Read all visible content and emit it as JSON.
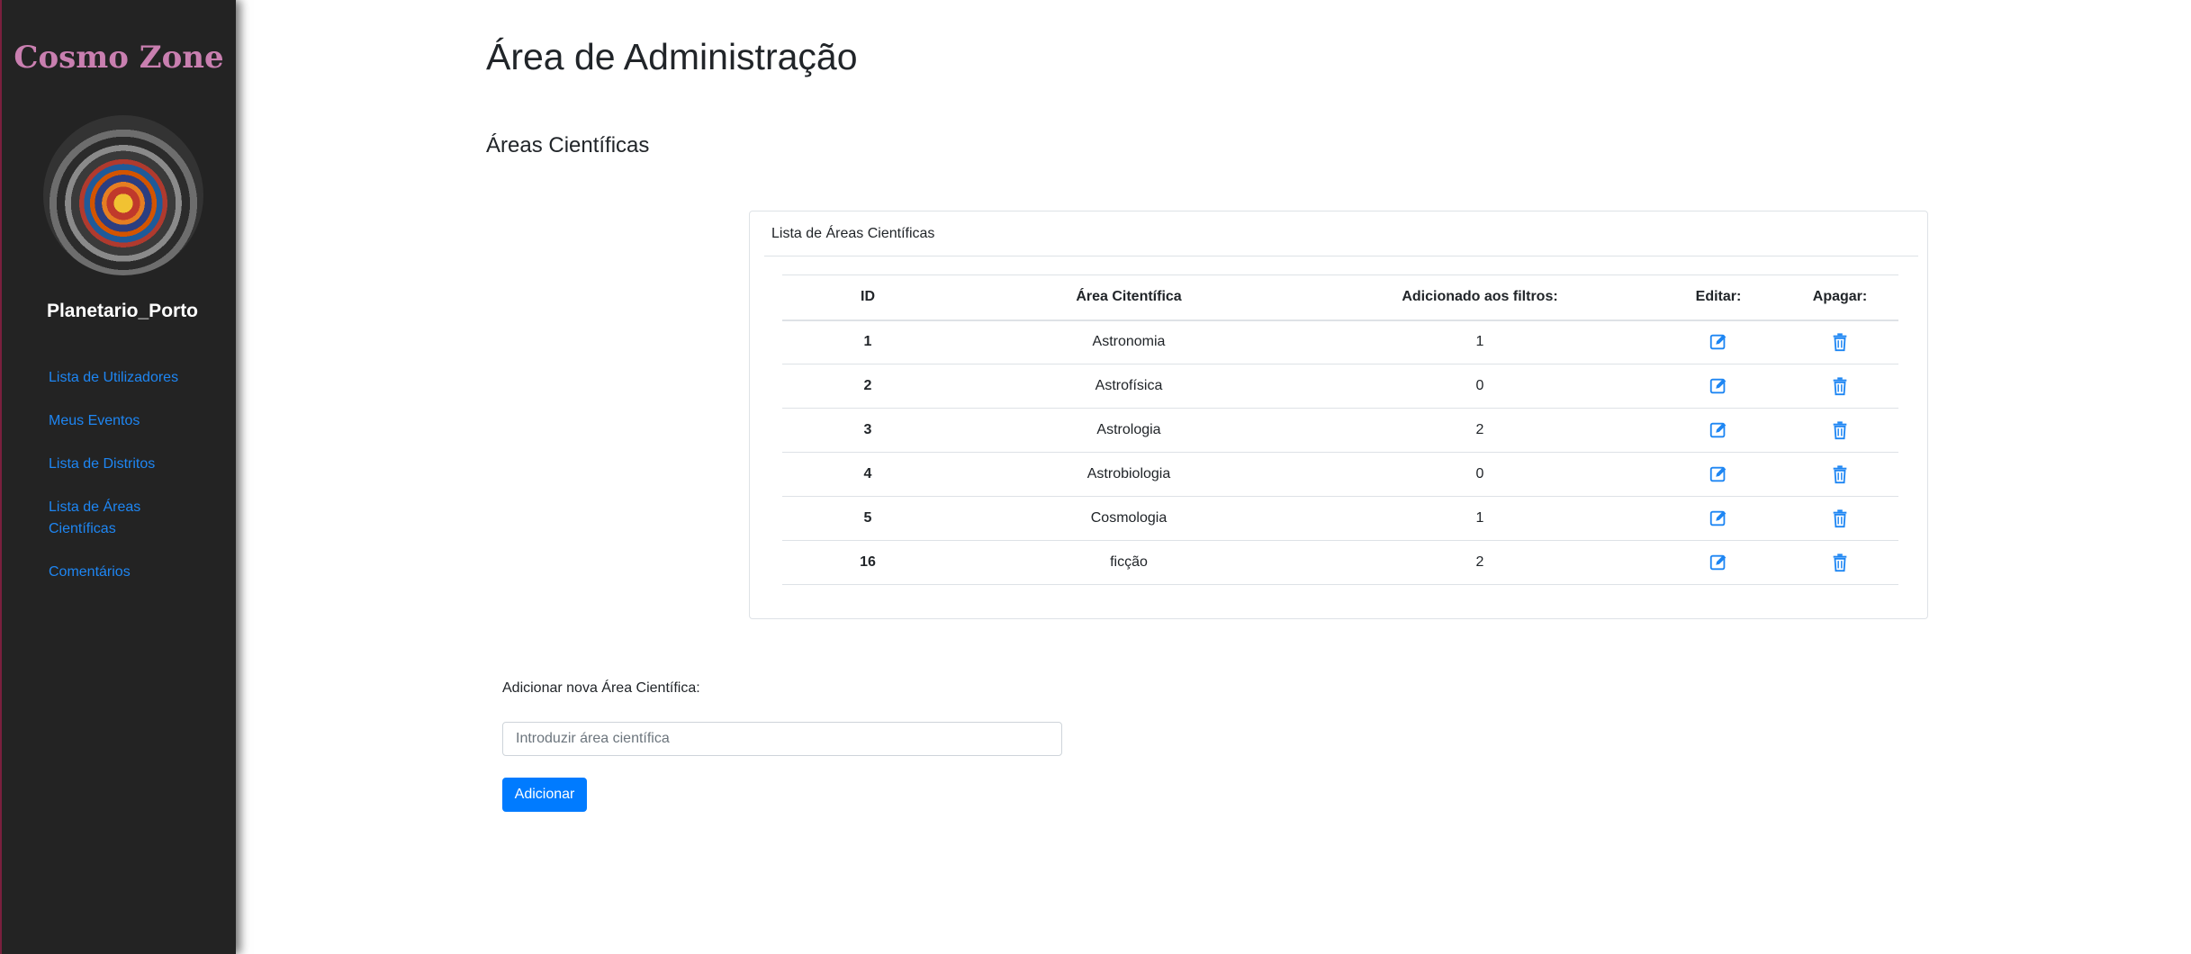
{
  "sidebar": {
    "brand": "Cosmo Zone",
    "username": "Planetario_Porto",
    "nav": [
      {
        "label": "Lista de Utilizadores"
      },
      {
        "label": "Meus Eventos"
      },
      {
        "label": "Lista de Distritos"
      },
      {
        "label": "Lista de Áreas Científicas"
      },
      {
        "label": "Comentários"
      }
    ]
  },
  "main": {
    "title": "Área de Administração",
    "section_title": "Áreas Científicas",
    "card_header": "Lista de Áreas Científicas",
    "table": {
      "headers": {
        "id": "ID",
        "area": "Área Citentífica",
        "filters": "Adicionado aos filtros:",
        "edit": "Editar:",
        "delete": "Apagar:"
      },
      "rows": [
        {
          "id": "1",
          "area": "Astronomia",
          "filters": "1"
        },
        {
          "id": "2",
          "area": "Astrofísica",
          "filters": "0"
        },
        {
          "id": "3",
          "area": "Astrologia",
          "filters": "2"
        },
        {
          "id": "4",
          "area": "Astrobiologia",
          "filters": "0"
        },
        {
          "id": "5",
          "area": "Cosmologia",
          "filters": "1"
        },
        {
          "id": "16",
          "area": "ficção",
          "filters": "2"
        }
      ]
    },
    "form": {
      "label": "Adicionar nova Área Científica:",
      "input_value": "",
      "input_placeholder": "Introduzir área científica",
      "submit_label": "Adicionar"
    }
  },
  "colors": {
    "sidebar_bg": "#232323",
    "link": "#1e86f3",
    "brand": "#c97fb0",
    "primary_button": "#007bff",
    "icon": "#1e86f3"
  },
  "icons": {
    "edit": "edit-icon",
    "delete": "trash-icon"
  }
}
